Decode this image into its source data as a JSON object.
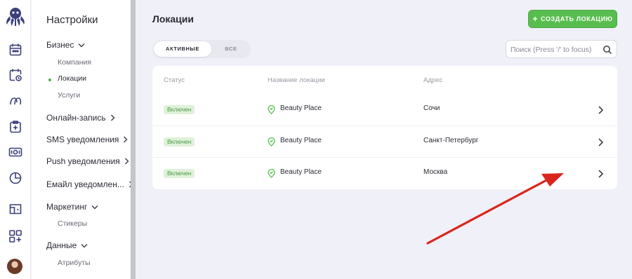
{
  "rail": {
    "icons": [
      "octopus-logo",
      "calendar-icon",
      "calendar-clock-icon",
      "clients-icon",
      "clipboard-icon",
      "cash-icon",
      "pie-chart-icon",
      "store-icon",
      "apps-icon"
    ]
  },
  "nav": {
    "title": "Настройки",
    "sections": [
      {
        "label": "Бизнес",
        "expanded": true,
        "items": [
          {
            "label": "Компания",
            "active": false
          },
          {
            "label": "Локации",
            "active": true
          },
          {
            "label": "Услуги",
            "active": false
          }
        ]
      },
      {
        "label": "Онлайн-запись",
        "expanded": false
      },
      {
        "label": "SMS уведомления",
        "expanded": false
      },
      {
        "label": "Push уведомления",
        "expanded": false
      },
      {
        "label": "Емайл уведомлен...",
        "expanded": false
      },
      {
        "label": "Маркетинг",
        "expanded": true,
        "items": [
          {
            "label": "Стикеры"
          }
        ]
      },
      {
        "label": "Данные",
        "expanded": true,
        "items": [
          {
            "label": "Атрибуты"
          }
        ]
      }
    ]
  },
  "main": {
    "title": "Локации",
    "create_button": "СОЗДАТЬ ЛОКАЦИЮ",
    "tabs": {
      "active": "АКТИВНЫЕ",
      "all": "ВСЕ"
    },
    "search_placeholder": "Поиск (Press '/' to focus)"
  },
  "table": {
    "headers": {
      "status": "Статус",
      "name": "Название локации",
      "address": "Адрес"
    },
    "rows": [
      {
        "status": "Включен",
        "name": "Beauty Place",
        "address": "Сочи"
      },
      {
        "status": "Включен",
        "name": "Beauty Place",
        "address": "Санкт-Петербург"
      },
      {
        "status": "Включен",
        "name": "Beauty Place",
        "address": "Москва"
      }
    ]
  },
  "colors": {
    "accent_green": "#58bd4f",
    "badge_bg": "#dff2d9",
    "badge_text": "#4a9a44",
    "background": "#f0f0f8",
    "annotation_arrow": "#d9261c"
  }
}
